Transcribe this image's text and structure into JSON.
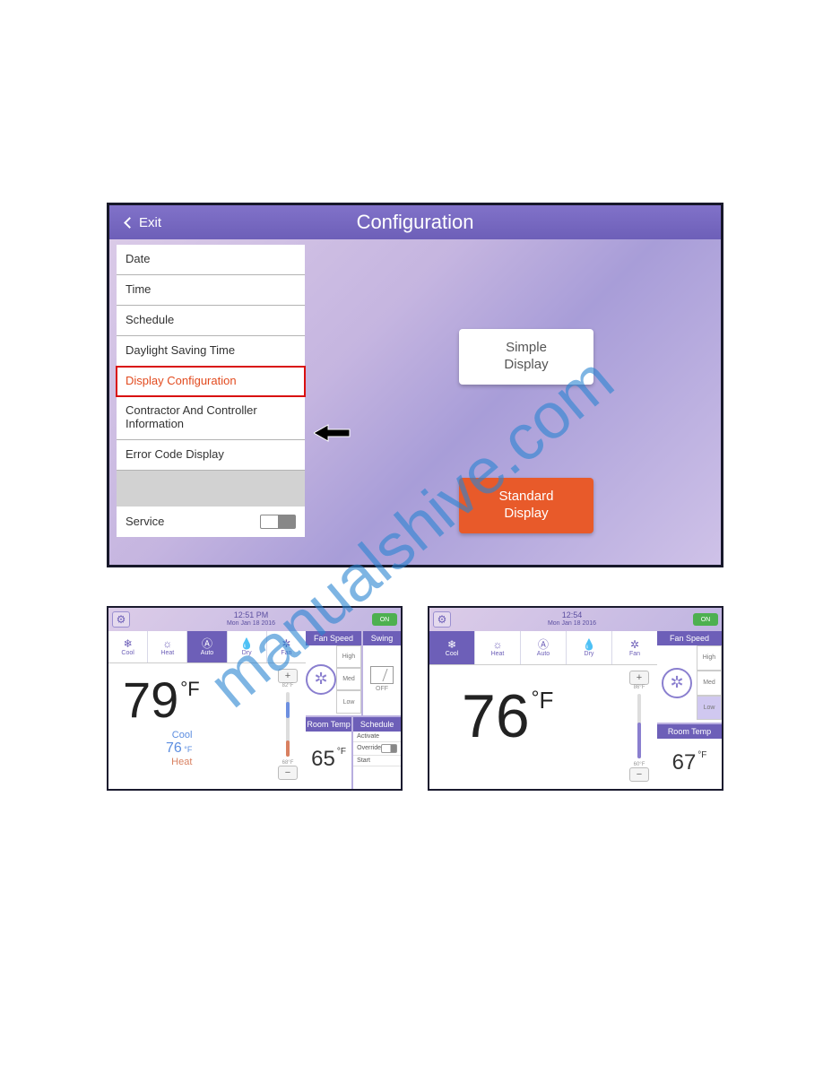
{
  "watermark": "manualshive.com",
  "config": {
    "title": "Configuration",
    "exit_label": "Exit",
    "menu": [
      "Date",
      "Time",
      "Schedule",
      "Daylight Saving Time",
      "Display Configuration",
      "Contractor And Controller Information",
      "Error Code Display"
    ],
    "selected_index": 4,
    "service_label": "Service",
    "simple_display_label": "Simple\nDisplay",
    "standard_display_label": "Standard\nDisplay"
  },
  "standard_panel": {
    "time": "12:51 PM",
    "date": "Mon Jan 18 2016",
    "on_label": "ON",
    "modes": [
      "Cool",
      "Heat",
      "Auto",
      "Dry",
      "Fan"
    ],
    "active_mode_index": 2,
    "main_temp": "79",
    "temp_unit": "°F",
    "cool_label": "Cool",
    "cool_setpoint": "76",
    "heat_label": "Heat",
    "slider_top": "82°F",
    "slider_bot": "68°F",
    "fan_header": "Fan Speed",
    "fan_levels": [
      "High",
      "Med",
      "Low"
    ],
    "swing_header": "Swing",
    "swing_state": "OFF",
    "room_header": "Room Temp",
    "room_temp": "65",
    "room_unit": "°F",
    "schedule_header": "Schedule",
    "schedule_rows": [
      "Activate",
      "Override",
      "Start"
    ]
  },
  "simple_panel": {
    "time": "12:54",
    "date": "Mon Jan 18 2016",
    "on_label": "ON",
    "modes": [
      "Cool",
      "Heat",
      "Auto",
      "Dry",
      "Fan"
    ],
    "active_mode_index": 0,
    "main_temp": "76",
    "temp_unit": "°F",
    "slider_top": "86°F",
    "slider_bot": "60°F",
    "fan_header": "Fan Speed",
    "fan_levels": [
      "High",
      "Med",
      "Low"
    ],
    "fan_active_index": 2,
    "room_header": "Room Temp",
    "room_temp": "67",
    "room_unit": "°F"
  }
}
